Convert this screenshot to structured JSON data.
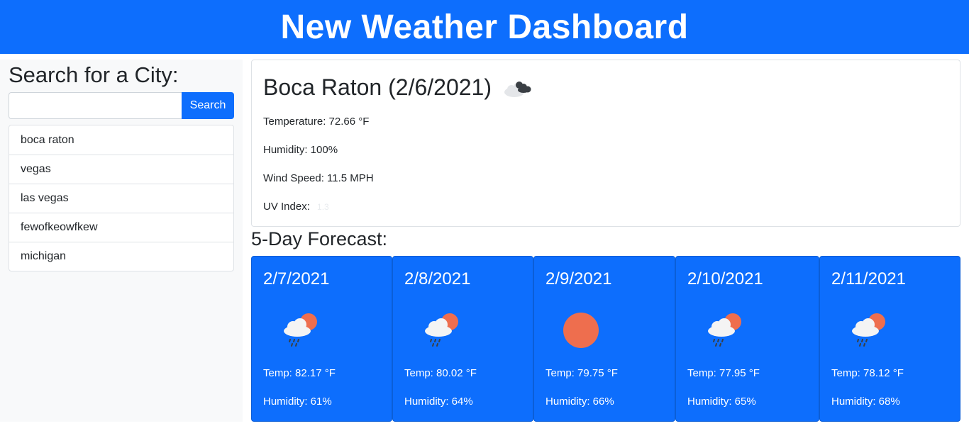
{
  "header": {
    "title": "New Weather Dashboard"
  },
  "sidebar": {
    "heading": "Search for a City:",
    "search": {
      "value": "",
      "placeholder": "",
      "button_label": "Search"
    },
    "history": [
      "boca raton",
      "vegas",
      "las vegas",
      "fewofkeowfkew",
      "michigan"
    ]
  },
  "current": {
    "title": "Boca Raton (2/6/2021)",
    "icon": "cloudy-icon",
    "temperature": "Temperature: 72.66 °F",
    "humidity": "Humidity: 100%",
    "wind": "Wind Speed: 11.5 MPH",
    "uv_label": "UV Index:",
    "uv_value": "1.3"
  },
  "forecast": {
    "heading": "5-Day Forecast:",
    "days": [
      {
        "date": "2/7/2021",
        "icon": "rain-sun-icon",
        "temp": "Temp: 82.17 °F",
        "humidity": "Humidity: 61%"
      },
      {
        "date": "2/8/2021",
        "icon": "rain-sun-icon",
        "temp": "Temp: 80.02 °F",
        "humidity": "Humidity: 64%"
      },
      {
        "date": "2/9/2021",
        "icon": "sun-icon",
        "temp": "Temp: 79.75 °F",
        "humidity": "Humidity: 66%"
      },
      {
        "date": "2/10/2021",
        "icon": "rain-sun-icon",
        "temp": "Temp: 77.95 °F",
        "humidity": "Humidity: 65%"
      },
      {
        "date": "2/11/2021",
        "icon": "rain-sun-icon",
        "temp": "Temp: 78.12 °F",
        "humidity": "Humidity: 68%"
      }
    ]
  },
  "colors": {
    "primary": "#0d6efd",
    "sun": "#ee6e4e",
    "sidebar_bg": "#f8f9fa"
  }
}
